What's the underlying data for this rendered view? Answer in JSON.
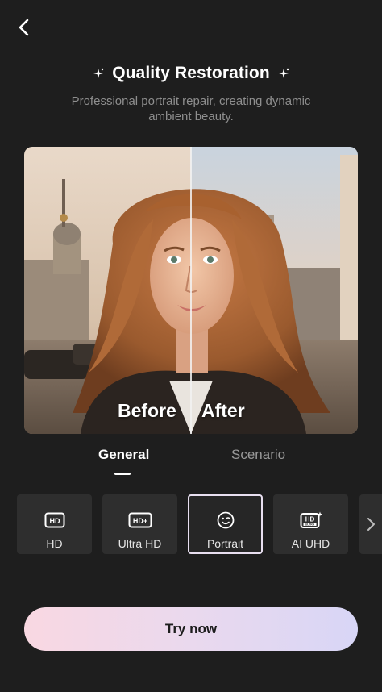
{
  "header": {
    "back_icon": "chevron-left-icon",
    "title": "Quality Restoration",
    "title_decoration_icon": "sparkle-icon",
    "subtitle": "Professional portrait repair, creating dynamic ambient beauty."
  },
  "preview": {
    "before_label": "Before",
    "after_label": "After"
  },
  "tabs": [
    {
      "label": "General",
      "active": true
    },
    {
      "label": "Scenario",
      "active": false
    }
  ],
  "options": [
    {
      "label": "HD",
      "icon": "hd-icon",
      "selected": false
    },
    {
      "label": "Ultra HD",
      "icon": "hd-plus-icon",
      "selected": false
    },
    {
      "label": "Portrait",
      "icon": "smile-face-icon",
      "selected": true
    },
    {
      "label": "AI UHD",
      "icon": "hd-ultra-icon",
      "selected": false
    }
  ],
  "options_more_icon": "chevron-right-icon",
  "cta": {
    "label": "Try now"
  },
  "colors": {
    "background": "#1e1e1e",
    "card": "#2e2e2e",
    "cta_gradient_start": "#f9d8e2",
    "cta_gradient_end": "#d8d6f6",
    "selected_border": "#e8dff0"
  }
}
